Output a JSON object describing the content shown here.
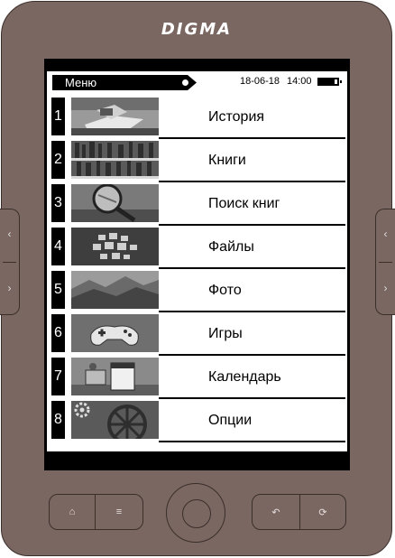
{
  "device": {
    "brand": "DIGMA"
  },
  "status": {
    "menu_label": "Меню",
    "date": "18-06-18",
    "time": "14:00"
  },
  "menu_items": [
    {
      "number": "1",
      "label": "История",
      "thumb": "open-book-photo"
    },
    {
      "number": "2",
      "label": "Книги",
      "thumb": "bookshelf-photo"
    },
    {
      "number": "3",
      "label": "Поиск книг",
      "thumb": "magnifier-photo"
    },
    {
      "number": "4",
      "label": "Файлы",
      "thumb": "cubes-photo"
    },
    {
      "number": "5",
      "label": "Фото",
      "thumb": "mountains-photo"
    },
    {
      "number": "6",
      "label": "Игры",
      "thumb": "gamepad-photo"
    },
    {
      "number": "7",
      "label": "Календарь",
      "thumb": "calendar-photo"
    },
    {
      "number": "8",
      "label": "Опции",
      "thumb": "gears-photo"
    }
  ],
  "hardware_buttons": {
    "home_icon": "⌂",
    "menu_icon": "≡",
    "back_icon": "↶",
    "rotate_icon": "⟳",
    "prev_icon": "‹",
    "next_icon": "›"
  },
  "colors": {
    "body": "#7a6762",
    "outline": "#3a2e2b",
    "screen": "#000000"
  }
}
